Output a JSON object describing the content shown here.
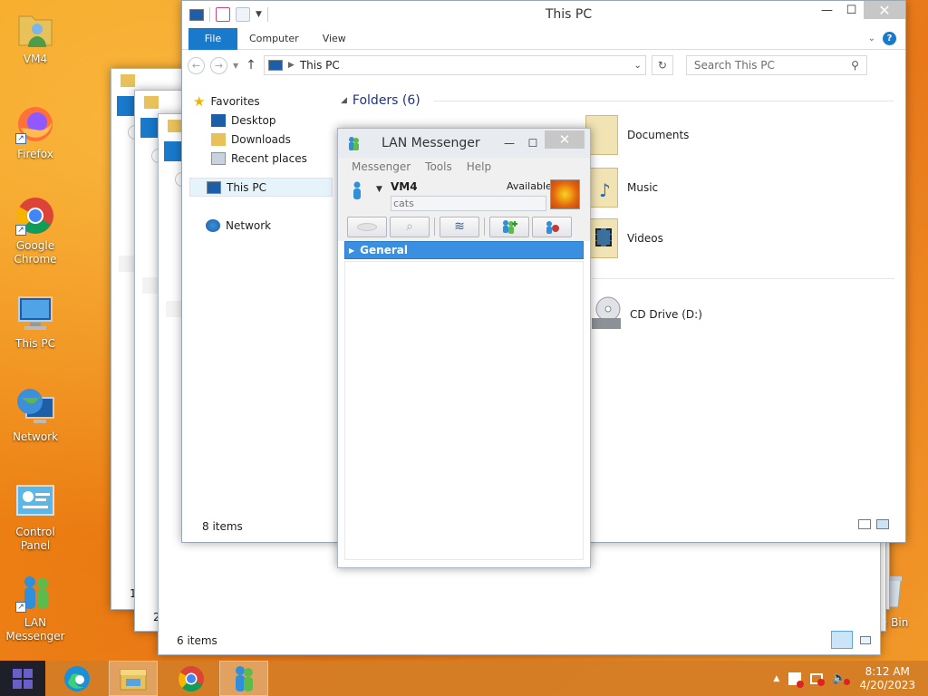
{
  "desktop": {
    "icons": [
      {
        "label": "VM4"
      },
      {
        "label": "Firefox"
      },
      {
        "label": "Google Chrome"
      },
      {
        "label": "This PC"
      },
      {
        "label": "Network"
      },
      {
        "label": "Control Panel"
      },
      {
        "label": "LAN Messenger"
      },
      {
        "label": "cle Bin"
      }
    ]
  },
  "explorer_main": {
    "title": "This PC",
    "ribbon_tabs": [
      "File",
      "Computer",
      "View"
    ],
    "address_path": "This PC",
    "search_placeholder": "Search This PC",
    "nav": {
      "favorites_label": "Favorites",
      "favorites_items": [
        "Desktop",
        "Downloads",
        "Recent places"
      ],
      "this_pc_label": "This PC",
      "network_label": "Network"
    },
    "folders_header": "Folders (6)",
    "folders": [
      "Documents",
      "Music",
      "Videos"
    ],
    "drives": [
      "CD Drive (D:)"
    ],
    "status": "8 items"
  },
  "explorer_back": {
    "status": "6 items",
    "tab_indicators": [
      "1",
      "2"
    ]
  },
  "lan_messenger": {
    "title": "LAN Messenger",
    "menu": [
      "Messenger",
      "Tools",
      "Help"
    ],
    "user_name": "VM4",
    "status": "Available",
    "note": "cats",
    "group": "General"
  },
  "taskbar": {
    "time": "8:12 AM",
    "date": "4/20/2023"
  },
  "colors": {
    "accent_blue": "#1979ca",
    "taskbar_orange": "#d37d26"
  }
}
